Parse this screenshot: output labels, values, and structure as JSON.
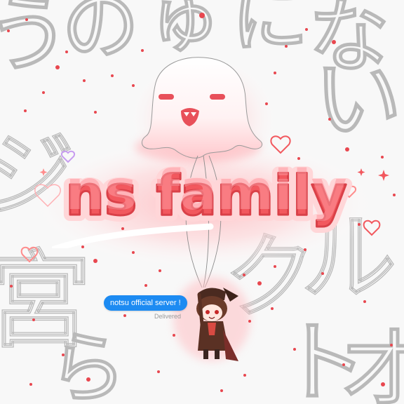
{
  "background": {
    "glyphs": [
      "う",
      "の",
      "ゅ",
      "に",
      "な",
      "い",
      "ジ",
      "宮",
      "ク",
      "ル",
      "ト",
      "ら",
      "才"
    ]
  },
  "logo": {
    "title": "ns family"
  },
  "message": {
    "text": "notsu official server !",
    "status": "Delivered",
    "bubble_color": "#1d8bf2"
  },
  "colors": {
    "accent": "#f2585e",
    "accent_light": "#ff9aa0",
    "glow": "#ffc4c8"
  },
  "icons": [
    "ghost-balloon-icon",
    "chibi-character-icon",
    "heart-icon",
    "sparkle-icon"
  ]
}
